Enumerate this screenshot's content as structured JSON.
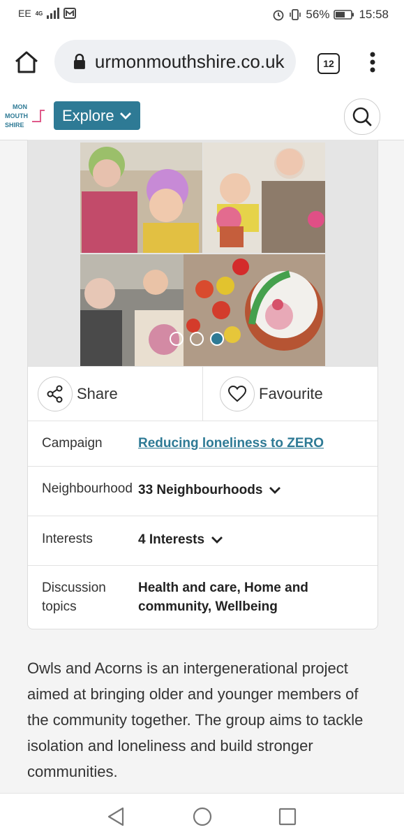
{
  "status": {
    "carrier": "EE",
    "network": "4G",
    "battery": "56%",
    "time": "15:58"
  },
  "browser": {
    "url": "urmonmouthshire.co.uk",
    "tab_count": "12"
  },
  "site": {
    "logo_lines": [
      "MON",
      "MOUTH",
      "SHIRE"
    ],
    "explore_label": "Explore",
    "accent_color": "#2e7a95"
  },
  "gallery": {
    "dot_count": 3,
    "active_dot": 3
  },
  "actions": {
    "share_label": "Share",
    "favourite_label": "Favourite"
  },
  "details": {
    "campaign_label": "Campaign",
    "campaign_value": "Reducing loneliness to ZERO",
    "neighbourhood_label": "Neighbourhood",
    "neighbourhood_value": "33 Neighbourhoods",
    "interests_label": "Interests",
    "interests_value": "4 Interests",
    "topics_label": "Discussion topics",
    "topics_value": "Health and care, Home and community, Wellbeing"
  },
  "description": "Owls and Acorns is an intergenerational project aimed at bringing older and younger members of the community together. The group aims to tackle isolation and loneliness and build stronger communities."
}
